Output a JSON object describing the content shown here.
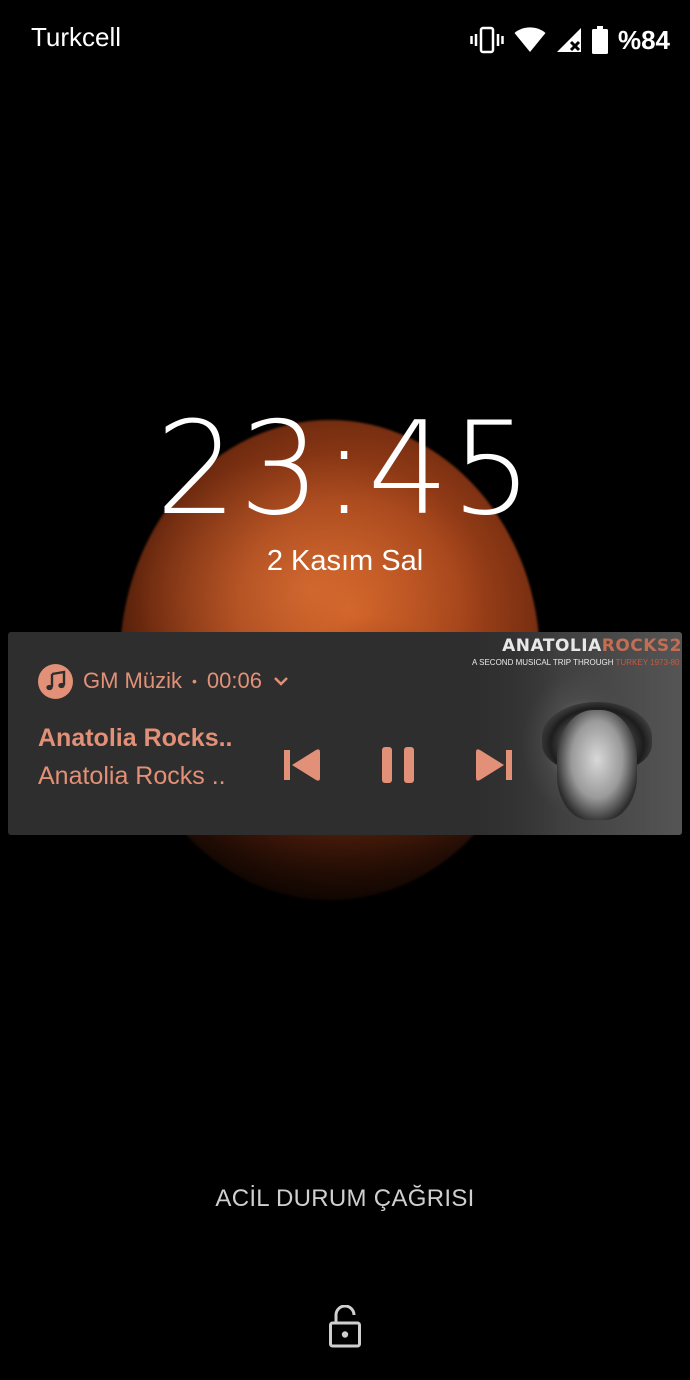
{
  "status_bar": {
    "carrier": "Turkcell",
    "battery_percent": "%84",
    "icons": [
      "vibrate-icon",
      "wifi-icon",
      "no-signal-icon",
      "battery-icon"
    ]
  },
  "lockscreen": {
    "time": "23:45",
    "date": "2 Kasım Sal"
  },
  "media_notification": {
    "app_name": "GM Müzik",
    "separator": "•",
    "elapsed": "00:06",
    "title": "Anatolia Rocks..",
    "artist": "Anatolia Rocks ..",
    "accent_color": "#e29077",
    "controls": [
      "previous-icon",
      "pause-icon",
      "next-icon"
    ],
    "album_art": {
      "title_prefix": "ANATOLIA",
      "title_suffix": "ROCKS2",
      "subtitle": "A SECOND MUSICAL TRIP THROUGH",
      "subtitle_highlight": "TURKEY 1973-80"
    }
  },
  "emergency_call_label": "ACİL DURUM ÇAĞRISI"
}
